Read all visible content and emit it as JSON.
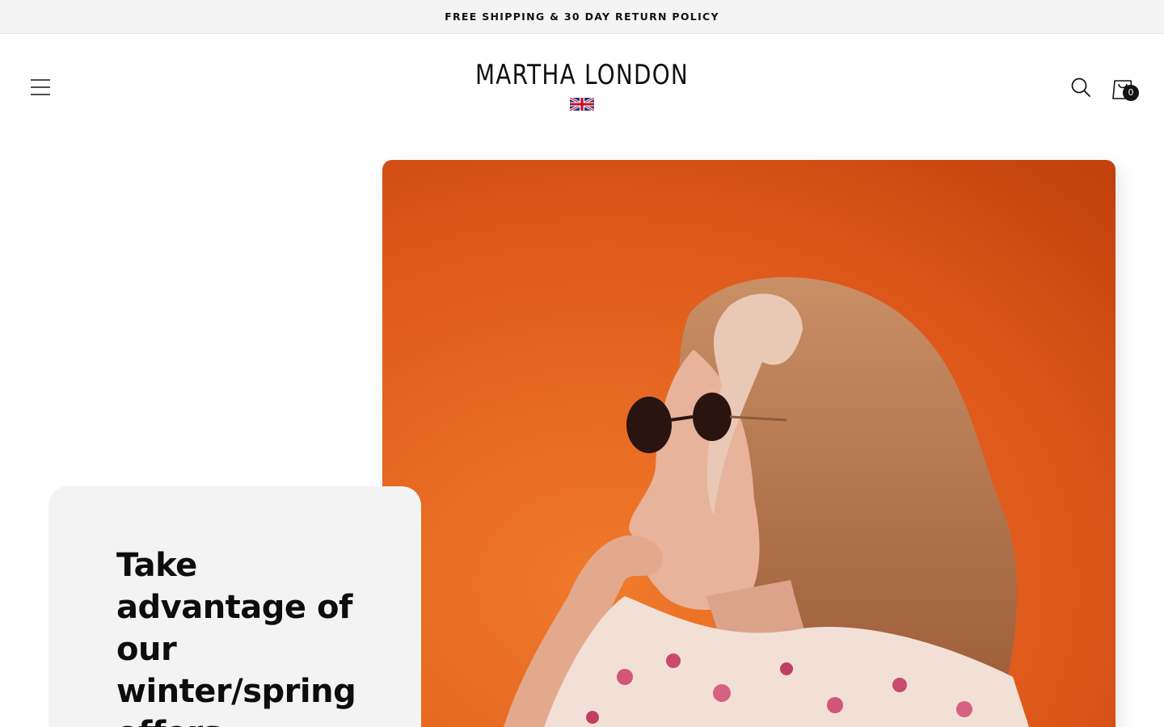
{
  "announcement": {
    "text": "FREE SHIPPING & 30 DAY RETURN POLICY"
  },
  "header": {
    "menu_icon": "hamburger-menu-icon",
    "logo_text": "MARTHA LONDON",
    "logo_flag": "uk-flag-icon",
    "search_icon": "search-icon",
    "cart_icon": "shopping-bag-icon",
    "cart_count": "0"
  },
  "hero": {
    "heading": "Take advantage of our winter/spring offers",
    "image": "woman-with-sunglasses-and-headscarf-photo",
    "background_color": "#d9531c"
  }
}
